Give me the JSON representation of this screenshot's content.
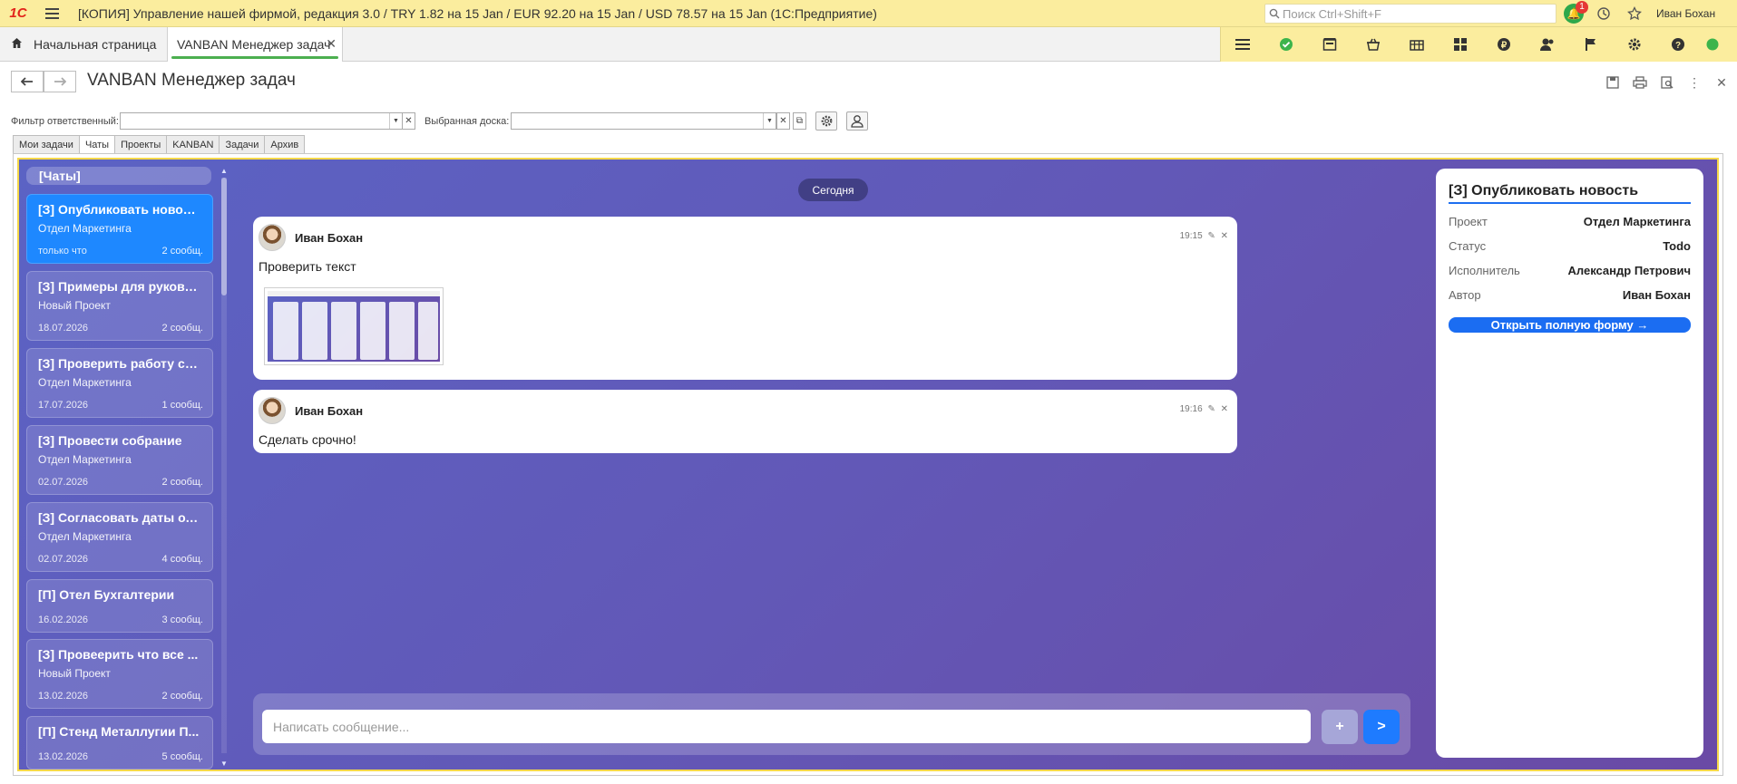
{
  "titlebar": {
    "logo": "1C",
    "title": "[КОПИЯ] Управление нашей фирмой, редакция 3.0 / TRY 1.82 на 15 Jan / EUR 92.20 на 15 Jan / USD 78.57 на 15 Jan  (1С:Предприятие)",
    "search_placeholder": "Поиск Ctrl+Shift+F",
    "notifications_count": "1",
    "user": "Иван Бохан"
  },
  "tabs": {
    "home": "Начальная страница",
    "open_tab": "VANBAN Менеджер задач"
  },
  "form": {
    "title": "VANBAN Менеджер задач",
    "filter_responsible_label": "Фильтр ответственный:",
    "filter_responsible_value": "",
    "selected_board_label": "Выбранная доска:",
    "selected_board_value": ""
  },
  "page_tabs": [
    "Мои задачи",
    "Чаты",
    "Проекты",
    "KANBAN",
    "Задачи",
    "Архив"
  ],
  "active_page_tab": "Чаты",
  "chat_list": {
    "header": "[Чаты]",
    "items": [
      {
        "title": "[З]  Опубликовать новость",
        "project": "Отдел Маркетинга",
        "date": "только что",
        "count": "2 сообщ."
      },
      {
        "title": "[З]  Примеры для руково...",
        "project": "Новый Проект",
        "date": "18.07.2026",
        "count": "2 сообщ."
      },
      {
        "title": "[З]  Проверить работу са...",
        "project": "Отдел Маркетинга",
        "date": "17.07.2026",
        "count": "1 сообщ."
      },
      {
        "title": "[З]  Провести собрание",
        "project": "Отдел Маркетинга",
        "date": "02.07.2026",
        "count": "2 сообщ."
      },
      {
        "title": "[З]  Согласовать даты отп...",
        "project": "Отдел Маркетинга",
        "date": "02.07.2026",
        "count": "4 сообщ."
      },
      {
        "title": "[П]  Отел Бухгалтерии",
        "project": "",
        "date": "16.02.2026",
        "count": "3 сообщ."
      },
      {
        "title": "[З]  Провеерить что все ...",
        "project": "Новый Проект",
        "date": "13.02.2026",
        "count": "2 сообщ."
      },
      {
        "title": "[П]  Стенд Металлугии П...",
        "project": "",
        "date": "13.02.2026",
        "count": "5 сообщ."
      }
    ]
  },
  "chat": {
    "day_label": "Сегодня",
    "messages": [
      {
        "author": "Иван Бохан",
        "time": "19:15",
        "text": "Проверить текст"
      },
      {
        "author": "Иван Бохан",
        "time": "19:16",
        "text": "Сделать срочно!"
      }
    ],
    "composer_placeholder": "Написать сообщение...",
    "attach_label": "+",
    "send_label": ">"
  },
  "details": {
    "title": "[З]  Опубликовать новость",
    "fields": [
      {
        "key": "Проект",
        "value": "Отдел Маркетинга"
      },
      {
        "key": "Статус",
        "value": "Todo"
      },
      {
        "key": "Исполнитель",
        "value": "Александр Петрович"
      },
      {
        "key": "Автор",
        "value": "Иван Бохан"
      }
    ],
    "open_button": "Открыть полную форму →"
  },
  "colors": {
    "titlebar_bg": "#fbed9e",
    "chat_gradient_start": "#5b63c4",
    "chat_gradient_end": "#6a4aa5",
    "selected_item": "#1e88ff",
    "send_button": "#1e7bff",
    "attach_button": "#a6a6d8",
    "accent_green": "#4caf50"
  }
}
